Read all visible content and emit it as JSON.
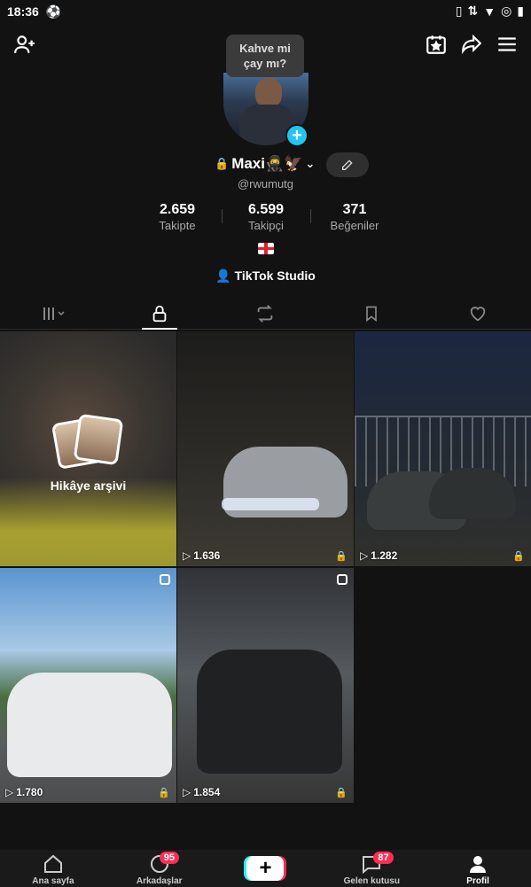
{
  "status": {
    "time": "18:36"
  },
  "tooltip": {
    "line1": "Kahve mi",
    "line2": "çay mı?"
  },
  "profile": {
    "name": "Maxi🥷🦅",
    "username": "@rwumutg",
    "stats": [
      {
        "value": "2.659",
        "label": "Takipte"
      },
      {
        "value": "6.599",
        "label": "Takipçi"
      },
      {
        "value": "371",
        "label": "Beğeniler"
      }
    ],
    "studio": "TikTok Studio"
  },
  "grid": {
    "archive_label": "Hikâye arşivi",
    "items": [
      {
        "views": "1.636"
      },
      {
        "views": "1.282"
      },
      {
        "views": "1.780"
      },
      {
        "views": "1.854"
      }
    ]
  },
  "bottom_nav": [
    {
      "label": "Ana sayfa"
    },
    {
      "label": "Arkadaşlar",
      "badge": "95"
    },
    {
      "label": ""
    },
    {
      "label": "Gelen kutusu",
      "badge": "87"
    },
    {
      "label": "Profil"
    }
  ],
  "colors": {
    "accent": "#20c5f0",
    "badge": "#ff2d55",
    "background": "#121212"
  }
}
